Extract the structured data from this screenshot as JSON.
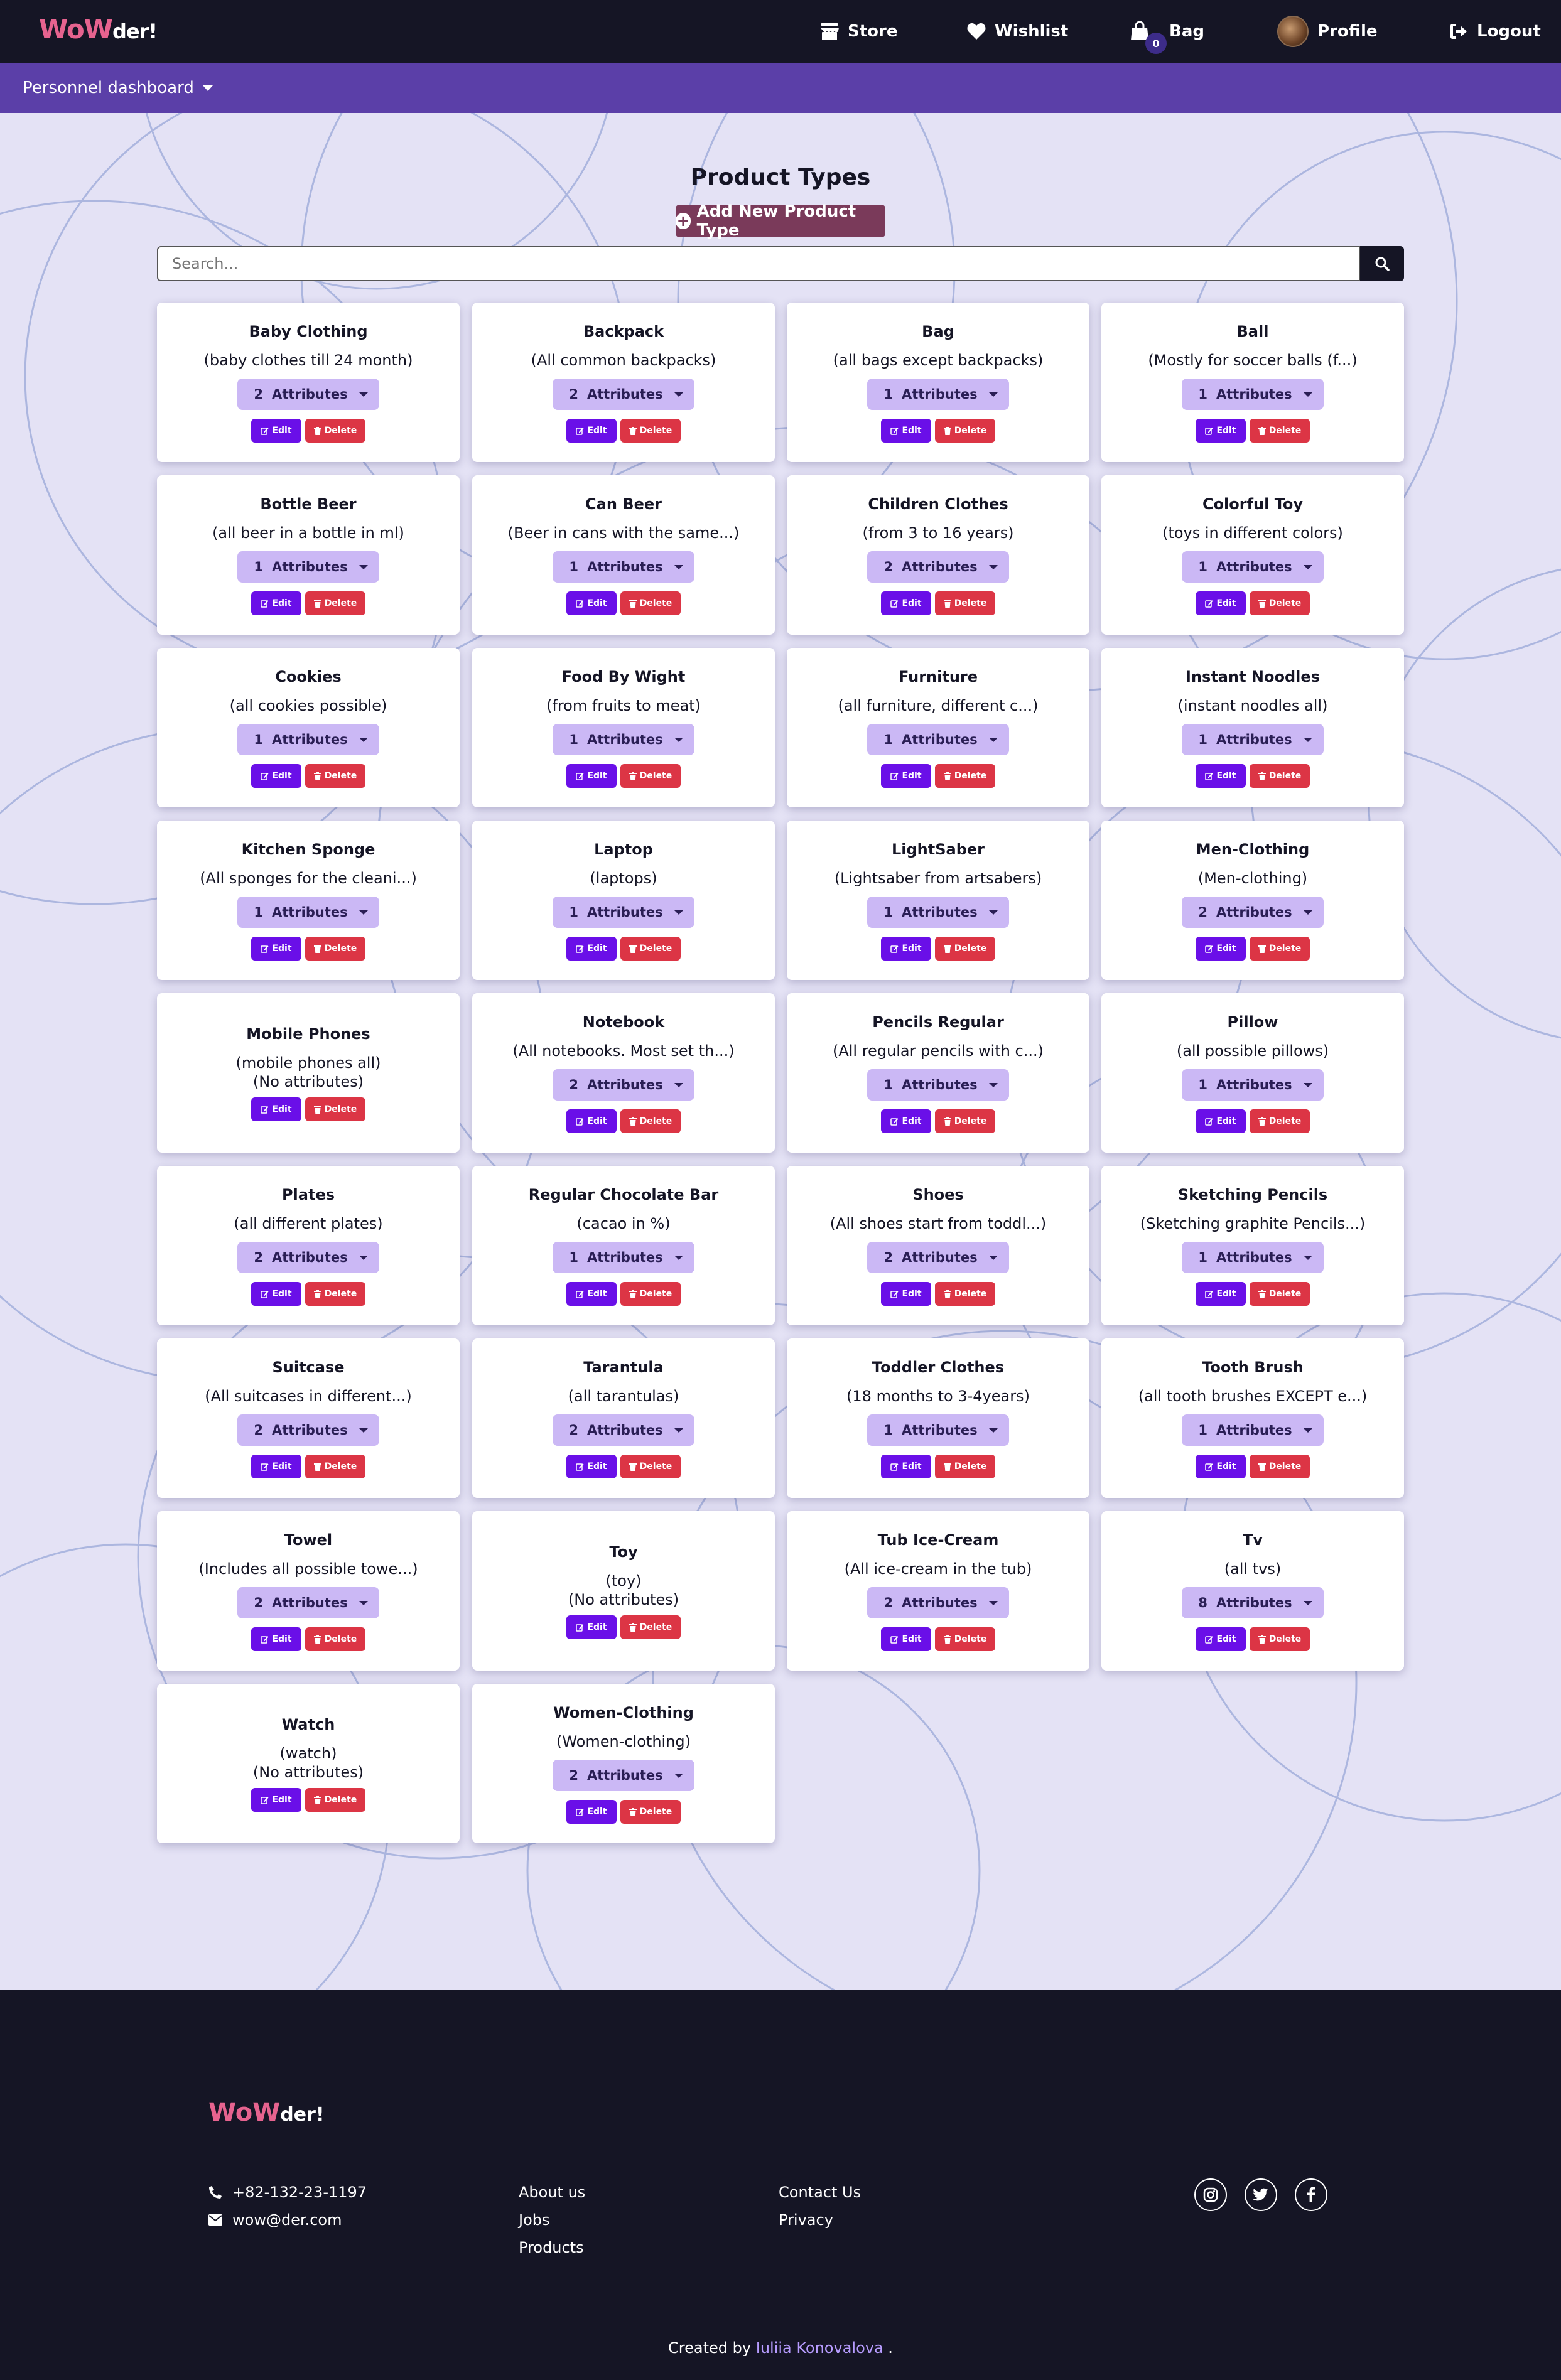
{
  "nav": {
    "logo_part1": "WoW",
    "logo_part2": "der!",
    "store": "Store",
    "wishlist": "Wishlist",
    "bag": "Bag",
    "bag_count": "0",
    "profile": "Profile",
    "logout": "Logout"
  },
  "subnav": {
    "dashboard": "Personnel dashboard"
  },
  "page": {
    "title": "Product Types",
    "add_button": "Add New Product Type",
    "search_placeholder": "Search..."
  },
  "labels": {
    "attributes": "Attributes",
    "edit": "Edit",
    "delete": "Delete"
  },
  "product_types": [
    {
      "name": "Baby Clothing",
      "desc": "(baby clothes till 24 month)",
      "attrs": "2"
    },
    {
      "name": "Backpack",
      "desc": "(All common backpacks)",
      "attrs": "2"
    },
    {
      "name": "Bag",
      "desc": "(all bags except backpacks)",
      "attrs": "1"
    },
    {
      "name": "Ball",
      "desc": "(Mostly for soccer balls (f...)",
      "attrs": "1"
    },
    {
      "name": "Bottle Beer",
      "desc": "(all beer in a bottle in ml)",
      "attrs": "1"
    },
    {
      "name": "Can Beer",
      "desc": "(Beer in cans with the same...)",
      "attrs": "1"
    },
    {
      "name": "Children Clothes",
      "desc": "(from 3 to 16 years)",
      "attrs": "2"
    },
    {
      "name": "Colorful Toy",
      "desc": "(toys in different colors)",
      "attrs": "1"
    },
    {
      "name": "Cookies",
      "desc": "(all cookies possible)",
      "attrs": "1"
    },
    {
      "name": "Food By Wight",
      "desc": "(from fruits to meat)",
      "attrs": "1"
    },
    {
      "name": "Furniture",
      "desc": "(all furniture, different c...)",
      "attrs": "1"
    },
    {
      "name": "Instant Noodles",
      "desc": "(instant noodles all)",
      "attrs": "1"
    },
    {
      "name": "Kitchen Sponge",
      "desc": "(All sponges for the cleani...)",
      "attrs": "1"
    },
    {
      "name": "Laptop",
      "desc": "(laptops)",
      "attrs": "1"
    },
    {
      "name": "LightSaber",
      "desc": "(Lightsaber from artsabers)",
      "attrs": "1"
    },
    {
      "name": "Men-Clothing",
      "desc": "(Men-clothing)",
      "attrs": "2"
    },
    {
      "name": "Mobile Phones",
      "desc": "(mobile phones all)",
      "attrs": null,
      "none": "(No attributes)"
    },
    {
      "name": "Notebook",
      "desc": "(All notebooks. Most set th...)",
      "attrs": "2"
    },
    {
      "name": "Pencils Regular",
      "desc": "(All regular pencils with c...)",
      "attrs": "1"
    },
    {
      "name": "Pillow",
      "desc": "(all possible pillows)",
      "attrs": "1"
    },
    {
      "name": "Plates",
      "desc": "(all different plates)",
      "attrs": "2"
    },
    {
      "name": "Regular Chocolate Bar",
      "desc": "(cacao in %)",
      "attrs": "1"
    },
    {
      "name": "Shoes",
      "desc": "(All shoes start from toddl...)",
      "attrs": "2"
    },
    {
      "name": "Sketching Pencils",
      "desc": "(Sketching graphite Pencils...)",
      "attrs": "1"
    },
    {
      "name": "Suitcase",
      "desc": "(All suitcases in different...)",
      "attrs": "2"
    },
    {
      "name": "Tarantula",
      "desc": "(all tarantulas)",
      "attrs": "2"
    },
    {
      "name": "Toddler Clothes",
      "desc": "(18 months to 3-4years)",
      "attrs": "1"
    },
    {
      "name": "Tooth Brush",
      "desc": "(all tooth brushes EXCEPT e...)",
      "attrs": "1"
    },
    {
      "name": "Towel",
      "desc": "(Includes all possible towe...)",
      "attrs": "2"
    },
    {
      "name": "Toy",
      "desc": "(toy)",
      "attrs": null,
      "none": "(No attributes)"
    },
    {
      "name": "Tub Ice-Cream",
      "desc": "(All ice-cream in the tub)",
      "attrs": "2"
    },
    {
      "name": "Tv",
      "desc": "(all tvs)",
      "attrs": "8"
    },
    {
      "name": "Watch",
      "desc": "(watch)",
      "attrs": null,
      "none": "(No attributes)"
    },
    {
      "name": "Women-Clothing",
      "desc": "(Women-clothing)",
      "attrs": "2"
    }
  ],
  "footer": {
    "logo_part1": "WoW",
    "logo_part2": "der!",
    "phone": "+82-132-23-1197",
    "email": "wow@der.com",
    "links1": [
      "About us",
      "Jobs",
      "Products"
    ],
    "links2": [
      "Contact Us",
      "Privacy"
    ],
    "credit_prefix": "Created by",
    "credit_name": "Iuliia Konovalova",
    "credit_suffix": "."
  }
}
